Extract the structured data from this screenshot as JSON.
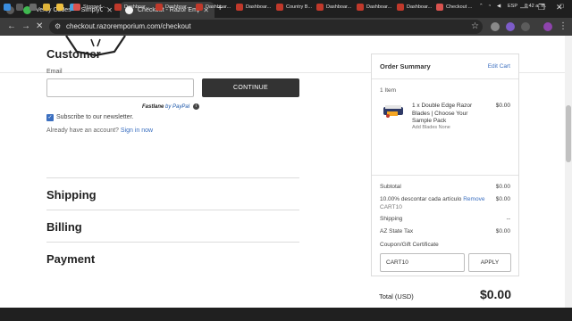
{
  "browser": {
    "tabs": [
      {
        "label": ""
      },
      {
        "label": "Verify Codes — SimplyCodes"
      },
      {
        "label": "Checkout - Razor Emporium"
      }
    ],
    "url": "checkout.razoremporium.com/checkout"
  },
  "customer": {
    "heading": "Customer",
    "email_label": "Email",
    "email_value": "",
    "continue_label": "CONTINUE",
    "fastlane_label": "Fastlane",
    "fastlane_by": "by PayPal",
    "subscribe_label": "Subscribe to our newsletter.",
    "subscribe_checked": true,
    "account_text": "Already have an account?",
    "signin_link": "Sign in now"
  },
  "sections": {
    "shipping": "Shipping",
    "billing": "Billing",
    "payment": "Payment"
  },
  "summary": {
    "title": "Order Summary",
    "edit_cart": "Edit Cart",
    "items_count": "1 Item",
    "product": {
      "name": "1 x Double Edge Razor Blades | Choose Your Sample Pack",
      "option": "Add Blades None",
      "price": "$0.00"
    },
    "subtotal_label": "Subtotal",
    "subtotal_value": "$0.00",
    "discount_label": "10.00% descontar cada artículo",
    "discount_remove": "Remove",
    "discount_code": "CART10",
    "discount_value": "$0.00",
    "shipping_label": "Shipping",
    "shipping_value": "--",
    "tax_label": "AZ State Tax",
    "tax_value": "$0.00",
    "coupon_label": "Coupon/Gift Certificate",
    "coupon_value": "CART10",
    "apply_label": "APPLY",
    "total_label": "Total (USD)",
    "total_value": "$0.00"
  },
  "taskbar": {
    "items": [
      {
        "label": "Stopped -..."
      },
      {
        "label": "Dashboar..."
      },
      {
        "label": "Dashboar..."
      },
      {
        "label": "Dashboar..."
      },
      {
        "label": "Dashboar..."
      },
      {
        "label": "Country B..."
      },
      {
        "label": "Dashboar..."
      },
      {
        "label": "Dashboar..."
      },
      {
        "label": "Dashboar..."
      },
      {
        "label": "Checkout ..."
      }
    ],
    "language": "ESP",
    "time": "8:42 a. m."
  },
  "colors": {
    "accent": "#3b6fc0",
    "button_dark": "#333333",
    "chrome_dark": "#1f1f1f"
  }
}
